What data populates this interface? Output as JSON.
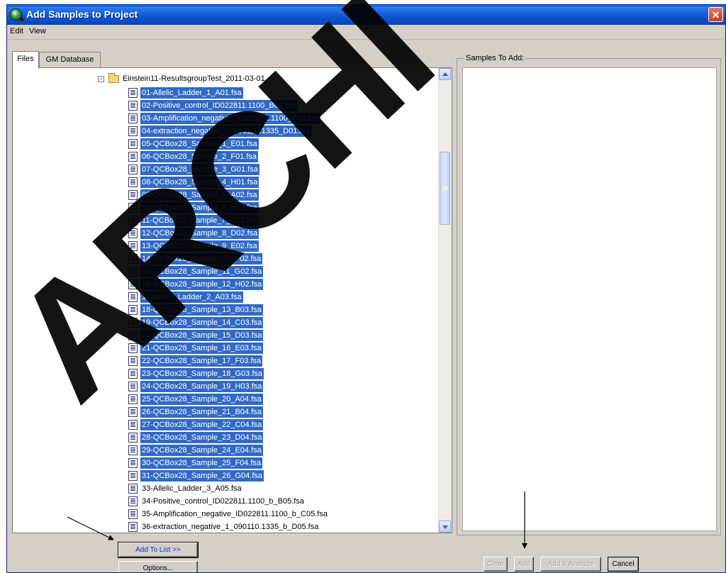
{
  "window": {
    "title": "Add Samples to Project",
    "close_glyph": "✕",
    "title_icon": "app-globe-icon"
  },
  "menu": {
    "items": [
      "Edit",
      "View"
    ]
  },
  "tabs": [
    {
      "label": "Files",
      "active": true
    },
    {
      "label": "GM Database",
      "active": false
    }
  ],
  "tree": {
    "folder": {
      "label": "Einstein11-ResultsgroupTest_2011-03-01",
      "expander": "−",
      "icon": "folder-icon"
    },
    "files": [
      {
        "name": "01-Allelic_Ladder_1_A01.fsa",
        "selected": true
      },
      {
        "name": "02-Positive_control_ID022811.1100_B01.fsa",
        "selected": true
      },
      {
        "name": "03-Amplification_negative_ID022811.1100_C01.fsa",
        "selected": true
      },
      {
        "name": "04-extraction_negative_1_090110.1335_D01.fsa",
        "selected": true
      },
      {
        "name": "05-QCBox28_Sample_1_E01.fsa",
        "selected": true
      },
      {
        "name": "06-QCBox28_Sample_2_F01.fsa",
        "selected": true
      },
      {
        "name": "07-QCBox28_Sample_3_G01.fsa",
        "selected": true
      },
      {
        "name": "08-QCBox28_Sample_4_H01.fsa",
        "selected": true
      },
      {
        "name": "09-QCBox28_Sample_5_A02.fsa",
        "selected": true
      },
      {
        "name": "10-QCBox28_Sample_6_B02.fsa",
        "selected": true
      },
      {
        "name": "11-QCBox28_Sample_7_C02.fsa",
        "selected": true
      },
      {
        "name": "12-QCBox28_Sample_8_D02.fsa",
        "selected": true
      },
      {
        "name": "13-QCBox28_Sample_9_E02.fsa",
        "selected": true
      },
      {
        "name": "14-QCBox28_Sample_10_F02.fsa",
        "selected": true
      },
      {
        "name": "15-QCBox28_Sample_11_G02.fsa",
        "selected": true
      },
      {
        "name": "16-QCBox28_Sample_12_H02.fsa",
        "selected": true
      },
      {
        "name": "17-Allelic_Ladder_2_A03.fsa",
        "selected": true
      },
      {
        "name": "18-QCBox28_Sample_13_B03.fsa",
        "selected": true
      },
      {
        "name": "19-QCBox28_Sample_14_C03.fsa",
        "selected": true
      },
      {
        "name": "20-QCBox28_Sample_15_D03.fsa",
        "selected": true
      },
      {
        "name": "21-QCBox28_Sample_16_E03.fsa",
        "selected": true
      },
      {
        "name": "22-QCBox28_Sample_17_F03.fsa",
        "selected": true
      },
      {
        "name": "23-QCBox28_Sample_18_G03.fsa",
        "selected": true
      },
      {
        "name": "24-QCBox28_Sample_19_H03.fsa",
        "selected": true
      },
      {
        "name": "25-QCBox28_Sample_20_A04.fsa",
        "selected": true
      },
      {
        "name": "26-QCBox28_Sample_21_B04.fsa",
        "selected": true
      },
      {
        "name": "27-QCBox28_Sample_22_C04.fsa",
        "selected": true
      },
      {
        "name": "28-QCBox28_Sample_23_D04.fsa",
        "selected": true
      },
      {
        "name": "29-QCBox28_Sample_24_E04.fsa",
        "selected": true
      },
      {
        "name": "30-QCBox28_Sample_25_F04.fsa",
        "selected": true
      },
      {
        "name": "31-QCBox28_Sample_26_G04.fsa",
        "selected": true
      },
      {
        "name": "33-Allelic_Ladder_3_A05.fsa",
        "selected": false
      },
      {
        "name": "34-Positive_control_ID022811.1100_b_B05.fsa",
        "selected": false
      },
      {
        "name": "35-Amplification_negative_ID022811.1100_b_C05.fsa",
        "selected": false
      },
      {
        "name": "36-extraction_negative_1_090110.1335_b_D05.fsa",
        "selected": false
      }
    ]
  },
  "samples_panel": {
    "legend": "Samples To Add:"
  },
  "buttons": {
    "add_to_list": "Add To List >>",
    "options": "Options...",
    "clear": "Clear",
    "add": "Add",
    "add_analyze": "Add & Analyze",
    "cancel": "Cancel"
  },
  "colors": {
    "selection": "#316ac5",
    "titlebar": "#0a5fd8",
    "dialog_bg": "#d4d0c8",
    "close": "#c9401c"
  },
  "watermark": {
    "text": "ARCHI"
  }
}
